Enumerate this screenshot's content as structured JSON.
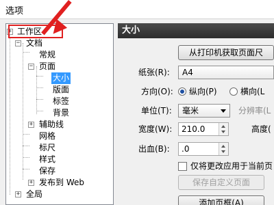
{
  "window": {
    "title": "选项"
  },
  "tree": {
    "items": [
      {
        "id": "workspace",
        "label": "工作区",
        "toggle": "+"
      },
      {
        "id": "document",
        "label": "文档",
        "toggle": "−"
      },
      {
        "id": "general",
        "label": "常规"
      },
      {
        "id": "page",
        "label": "页面",
        "toggle": "−"
      },
      {
        "id": "size",
        "label": "大小"
      },
      {
        "id": "layout",
        "label": "版面"
      },
      {
        "id": "label",
        "label": "标签"
      },
      {
        "id": "background",
        "label": "背景"
      },
      {
        "id": "guidelines",
        "label": "辅助线",
        "toggle": "+"
      },
      {
        "id": "grid",
        "label": "网格"
      },
      {
        "id": "rulers",
        "label": "标尺"
      },
      {
        "id": "styles",
        "label": "样式"
      },
      {
        "id": "save",
        "label": "保存"
      },
      {
        "id": "publish",
        "label": "发布到 Web",
        "toggle": "+"
      },
      {
        "id": "global",
        "label": "全局",
        "toggle": "+"
      }
    ],
    "selected": "size"
  },
  "panel": {
    "title": "大小",
    "get_from_printer_label": "从打印机获取页面尺",
    "paper_label": "纸张(R):",
    "paper_value": "A4",
    "orientation_label": "方向(O):",
    "portrait_label": "纵向(P)",
    "landscape_label": "横向(L",
    "orientation_selected": "portrait",
    "unit_label": "单位(T):",
    "unit_value": "毫米",
    "resolution_label": "分辨率(L",
    "width_label": "宽度(W):",
    "width_value": "210.0",
    "height_label": "高度(",
    "bleed_label": "出血(B):",
    "bleed_value": ".0",
    "apply_current_only_label": "仅将更改应用于当前页",
    "apply_current_only_checked": false,
    "save_custom_label": "保存自定义页面",
    "add_frame_label": "添加页框(A)"
  },
  "colors": {
    "annotation_red": "#e02020",
    "selection_blue": "#3399ff",
    "header_dark": "#3a3a3a"
  }
}
